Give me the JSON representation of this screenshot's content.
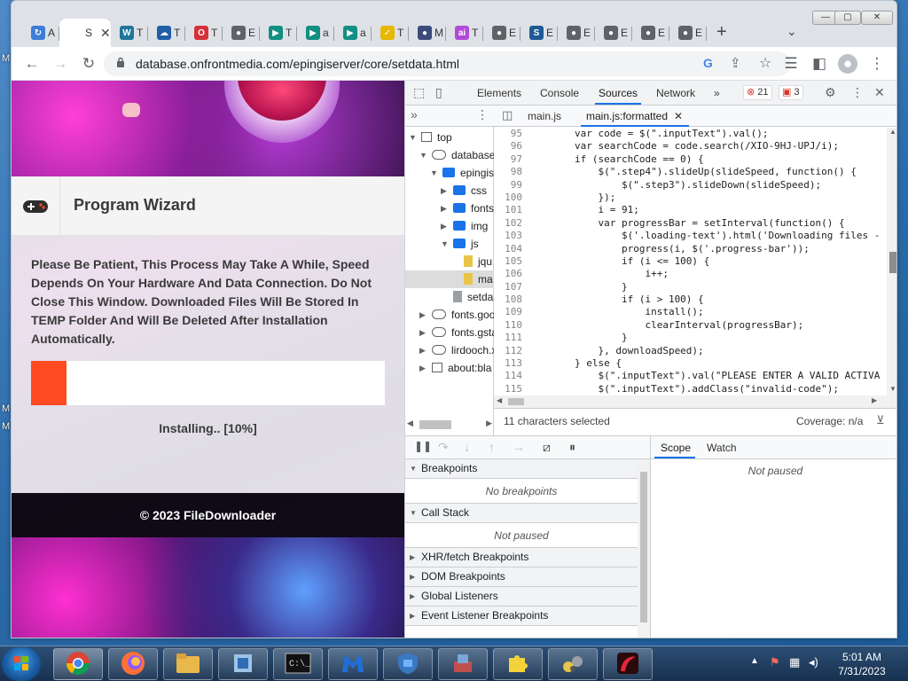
{
  "browser": {
    "tabs": [
      {
        "fav_letter": "↻",
        "short": "A",
        "color": "#3d7dd6"
      },
      {
        "fav_letter": "",
        "short": "S",
        "active": true
      },
      {
        "fav_letter": "W",
        "short": "T",
        "color": "#21759b"
      },
      {
        "fav_letter": "☁",
        "short": "T",
        "color": "#1f5fa8"
      },
      {
        "fav_letter": "O",
        "short": "T",
        "color": "#d6303a"
      },
      {
        "fav_letter": "●",
        "short": "E",
        "color": "#5f6368"
      },
      {
        "fav_letter": "▶",
        "short": "T",
        "color": "#118f82"
      },
      {
        "fav_letter": "▶",
        "short": "a",
        "color": "#118f82"
      },
      {
        "fav_letter": "▶",
        "short": "a",
        "color": "#118f82"
      },
      {
        "fav_letter": "✓",
        "short": "T",
        "color": "#e6b800"
      },
      {
        "fav_letter": "●",
        "short": "M",
        "color": "#3b4a7a"
      },
      {
        "fav_letter": "ai",
        "short": "T",
        "color": "#b04ad8"
      },
      {
        "fav_letter": "●",
        "short": "E",
        "color": "#5f6368"
      },
      {
        "fav_letter": "S",
        "short": "E",
        "color": "#1e5a95"
      },
      {
        "fav_letter": "●",
        "short": "E",
        "color": "#5f6368"
      },
      {
        "fav_letter": "●",
        "short": "E",
        "color": "#5f6368"
      },
      {
        "fav_letter": "●",
        "short": "E",
        "color": "#5f6368"
      },
      {
        "fav_letter": "●",
        "short": "E",
        "color": "#5f6368"
      }
    ],
    "new_tab": "+",
    "tab_close": "✕",
    "url": "database.onfrontmedia.com/epingiserver/core/setdata.html",
    "window_controls": {
      "minimize": "—",
      "maximize": "▢",
      "close": "✕"
    }
  },
  "wizard": {
    "title": "Program Wizard",
    "message": "Please Be Patient, This Process May Take A While, Speed Depends On Your Hardware And Data Connection. Do Not Close This Window. Downloaded Files Will Be Stored In TEMP Folder And Will Be Deleted After Installation Automatically.",
    "progress_fraction": 0.1,
    "status": "Installing.. [10%]",
    "footer": "© 2023 FileDownloader",
    "accent_color": "#ff4a22",
    "icon": "gamepad-icon"
  },
  "devtools": {
    "tabs": [
      "Elements",
      "Console",
      "Sources",
      "Network"
    ],
    "active_tab": "Sources",
    "more_tabs": "»",
    "errors": "21",
    "warnings": "3",
    "navigator": {
      "tree": [
        {
          "label": "top",
          "icon": "frame",
          "depth": 0,
          "twisty": "▼"
        },
        {
          "label": "database.",
          "icon": "cloud",
          "depth": 1,
          "twisty": "▼"
        },
        {
          "label": "epingis",
          "icon": "folder",
          "depth": 2,
          "twisty": "▼"
        },
        {
          "label": "css",
          "icon": "folder",
          "depth": 3,
          "twisty": "▶"
        },
        {
          "label": "fonts",
          "icon": "folder",
          "depth": 3,
          "twisty": "▶"
        },
        {
          "label": "img",
          "icon": "folder",
          "depth": 3,
          "twisty": "▶"
        },
        {
          "label": "js",
          "icon": "folder",
          "depth": 3,
          "twisty": "▼"
        },
        {
          "label": "jqu",
          "icon": "filey",
          "depth": 4,
          "twisty": ""
        },
        {
          "label": "ma",
          "icon": "filey",
          "depth": 4,
          "twisty": "",
          "selected": true
        },
        {
          "label": "setda",
          "icon": "fileg",
          "depth": 3,
          "twisty": ""
        },
        {
          "label": "fonts.goo",
          "icon": "cloud",
          "depth": 1,
          "twisty": "▶"
        },
        {
          "label": "fonts.gsta",
          "icon": "cloud",
          "depth": 1,
          "twisty": "▶"
        },
        {
          "label": "lirdooch.x",
          "icon": "cloud",
          "depth": 1,
          "twisty": "▶"
        },
        {
          "label": "about:bla",
          "icon": "frame",
          "depth": 1,
          "twisty": "▶"
        }
      ]
    },
    "editor_tabs": [
      "main.js",
      "main.js:formatted"
    ],
    "active_editor_tab": "main.js:formatted",
    "code_lines": [
      {
        "n": "95",
        "t": "        var code = $(\".inputText\").val();"
      },
      {
        "n": "96",
        "t": "        var searchCode = code.search(/XIO-9HJ-UPJ/i);"
      },
      {
        "n": "97",
        "t": "        if (searchCode == 0) {"
      },
      {
        "n": "98",
        "t": "            $(\".step4\").slideUp(slideSpeed, function() {"
      },
      {
        "n": "99",
        "t": "                $(\".step3\").slideDown(slideSpeed);"
      },
      {
        "n": "100",
        "t": "            });"
      },
      {
        "n": "101",
        "t": "            i = 91;"
      },
      {
        "n": "102",
        "t": "            var progressBar = setInterval(function() {"
      },
      {
        "n": "103",
        "t": "                $('.loading-text').html('Downloading files -"
      },
      {
        "n": "104",
        "t": "                progress(i, $('.progress-bar'));"
      },
      {
        "n": "105",
        "t": "                if (i <= 100) {"
      },
      {
        "n": "106",
        "t": "                    i++;"
      },
      {
        "n": "107",
        "t": "                }"
      },
      {
        "n": "108",
        "t": "                if (i > 100) {"
      },
      {
        "n": "109",
        "t": "                    install();"
      },
      {
        "n": "110",
        "t": "                    clearInterval(progressBar);"
      },
      {
        "n": "111",
        "t": "                }"
      },
      {
        "n": "112",
        "t": "            }, downloadSpeed);"
      },
      {
        "n": "113",
        "t": "        } else {"
      },
      {
        "n": "114",
        "t": "            $(\".inputText\").val(\"PLEASE ENTER A VALID ACTIVA"
      },
      {
        "n": "115",
        "t": "            $(\".inputText\").addClass(\"invalid-code\");"
      }
    ],
    "status_selection": "11 characters selected",
    "coverage": "Coverage: n/a",
    "debugger": {
      "sections": [
        {
          "label": "Breakpoints",
          "open": true,
          "body": "No breakpoints"
        },
        {
          "label": "Call Stack",
          "open": true,
          "body": "Not paused"
        },
        {
          "label": "XHR/fetch Breakpoints",
          "open": false
        },
        {
          "label": "DOM Breakpoints",
          "open": false
        },
        {
          "label": "Global Listeners",
          "open": false
        },
        {
          "label": "Event Listener Breakpoints",
          "open": false
        }
      ],
      "scope_tabs": [
        "Scope",
        "Watch"
      ],
      "active_scope_tab": "Scope",
      "scope_body": "Not paused"
    }
  },
  "desktop": {
    "side_labels": [
      "M",
      "M",
      "M"
    ]
  },
  "taskbar": {
    "apps": [
      {
        "name": "chrome-icon",
        "active": true
      },
      {
        "name": "firefox-icon"
      },
      {
        "name": "file-explorer-icon"
      },
      {
        "name": "installer-icon"
      },
      {
        "name": "cmd-icon"
      },
      {
        "name": "malwarebytes-icon"
      },
      {
        "name": "security-icon"
      },
      {
        "name": "tool-icon"
      },
      {
        "name": "puzzle-icon"
      },
      {
        "name": "network-tool-icon"
      },
      {
        "name": "red-app-icon"
      }
    ],
    "time": "5:01 AM",
    "date": "7/31/2023"
  }
}
